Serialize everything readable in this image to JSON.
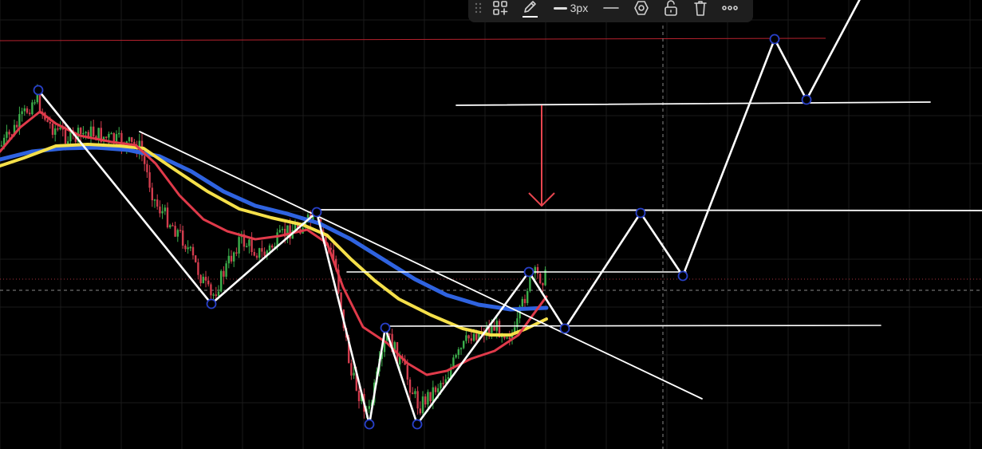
{
  "toolbar": {
    "line_width_label": "3px",
    "icons": [
      "drag-grip-icon",
      "templates-icon",
      "pencil-icon",
      "line-width-icon",
      "line-style-icon",
      "settings-hex-icon",
      "lock-icon",
      "trash-icon",
      "more-icon"
    ]
  },
  "colors": {
    "background": "#000000",
    "grid": "#1a1a1a",
    "drawings": "#ffffff",
    "arrow": "#e8464f",
    "ma_fast": "#e03a4a",
    "ma_mid": "#f5e04a",
    "ma_slow": "#2f63e0",
    "candle_up": "#3cae4b",
    "candle_down": "#d23d4e",
    "marker": "#2840c8"
  }
}
